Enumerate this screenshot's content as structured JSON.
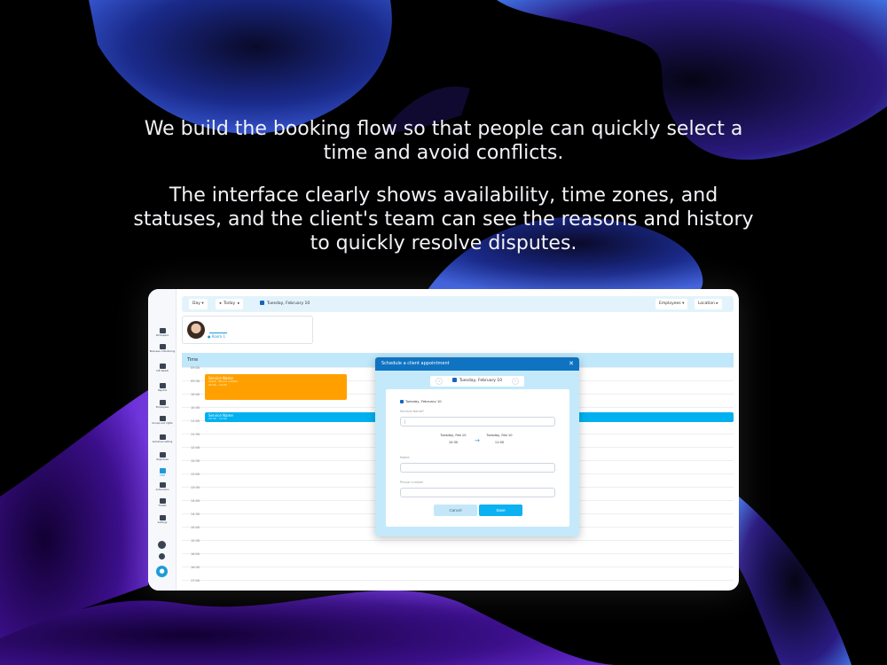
{
  "headline": {
    "paragraph1": "We build the booking flow so that people can quickly select a time and avoid conflicts.",
    "paragraph2": "The interface clearly shows availability, time zones, and statuses, and the client's team can see the reasons and history to quickly resolve disputes."
  },
  "colors": {
    "accent": "#1e9bd7",
    "modal_header": "#0f73c1",
    "event_orange": "#ffa000",
    "event_blue": "#00b0ef",
    "time_header": "#bfe8fb"
  },
  "sidebar": {
    "items": [
      {
        "label": "Workspace",
        "icon": "monitor-icon"
      },
      {
        "label": "Business x Monitoring",
        "icon": "dashboard-icon"
      },
      {
        "label": "CIE details",
        "icon": "id-card-icon"
      },
      {
        "label": "Reports",
        "icon": "report-icon"
      },
      {
        "label": "Employees",
        "icon": "people-icon"
      },
      {
        "label": "Groups and rights",
        "icon": "lock-icon"
      },
      {
        "label": "Autoshow setting",
        "icon": "phone-icon"
      },
      {
        "label": "Objectives",
        "icon": "list-icon"
      },
      {
        "label": "CRM",
        "icon": "chat-icon"
      },
      {
        "label": "Automation",
        "icon": "wrench-icon"
      },
      {
        "label": "Tickets",
        "icon": "ticket-icon"
      },
      {
        "label": "Settings",
        "icon": "gear-icon"
      }
    ]
  },
  "toolbar": {
    "view": "Day",
    "today": "Today",
    "date": "Tuesday, February 10",
    "employees": "Employees",
    "location": "Location"
  },
  "staff": {
    "room": "Room 1"
  },
  "grid": {
    "time_header": "Time",
    "slots": [
      "09:00",
      "09:30",
      "10:00",
      "10:30",
      "11:00",
      "11:30",
      "12:00",
      "12:30",
      "13:00",
      "13:30",
      "14:00",
      "14:30",
      "15:00",
      "15:30",
      "16:00",
      "16:30",
      "17:00"
    ]
  },
  "events": [
    {
      "title": "Service Name",
      "subtitle": "Client · Phone number",
      "time": "09:00 – 10:00"
    },
    {
      "title": "Service Name",
      "subtitle": "10:30 – 11:00"
    }
  ],
  "modal": {
    "title": "Schedule a client appointment",
    "date_bar": "Tuesday, February 10",
    "selected_date": "Tuesday, February 10",
    "service_label": "Service Name*",
    "service_value": "|",
    "from_date": "Tuesday, Feb 10",
    "from_time": "10:30",
    "to_date": "Tuesday, Feb 10",
    "to_time": "11:00",
    "name_label": "Name",
    "phone_label": "Phone number",
    "cancel": "Cancel",
    "save": "Save"
  }
}
